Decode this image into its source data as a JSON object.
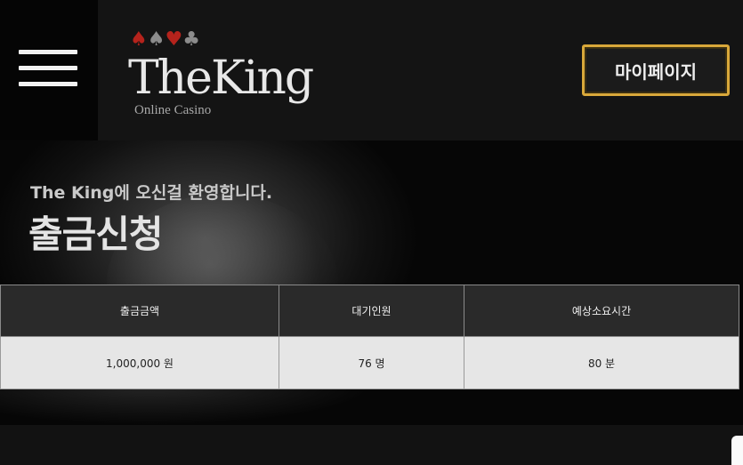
{
  "header": {
    "menu_icon": "hamburger-menu-icon",
    "logo": {
      "suits": [
        "♠",
        "♠",
        "♥",
        "♣"
      ],
      "title": "TheKing",
      "subtitle": "Online Casino"
    },
    "mypage_label": "마이페이지"
  },
  "hero": {
    "welcome": "The King에 오신걸 환영합니다.",
    "title": "출금신청"
  },
  "table": {
    "headers": [
      "출금금액",
      "대기인원",
      "예상소요시간"
    ],
    "values": [
      "1,000,000 원",
      "76 명",
      "80 분"
    ]
  },
  "colors": {
    "accent_gold": "#d9a83a",
    "suit_red": "#b5231c",
    "header_bg": "#141414",
    "table_header_bg": "#2a2a2a",
    "table_cell_bg": "#e6e6e6"
  }
}
